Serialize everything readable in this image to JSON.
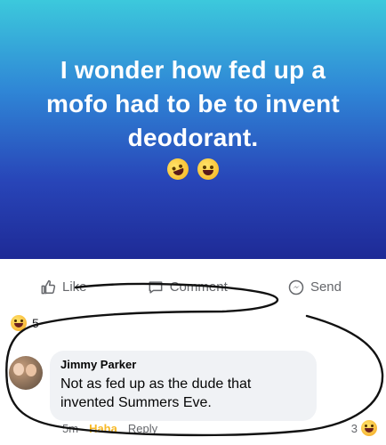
{
  "post": {
    "text": "I wonder how fed up a mofo had to be to invent deodorant.",
    "emojis": [
      "rolling-on-floor-laughing",
      "face-with-tears-of-joy"
    ]
  },
  "actions": {
    "like_label": "Like",
    "comment_label": "Comment",
    "send_label": "Send"
  },
  "reactions": {
    "icon": "laughing-emoji",
    "count": "5"
  },
  "comment": {
    "author": "Jimmy Parker",
    "text": "Not as fed up as the dude that invented Summers Eve.",
    "time": "5m",
    "haha_label": "Haha",
    "reply_label": "Reply",
    "reaction_count": "3"
  },
  "colors": {
    "haha": "#f7b928",
    "meta_text": "#65676b",
    "bubble": "#f0f2f5",
    "annotation_ink": "#111111"
  }
}
